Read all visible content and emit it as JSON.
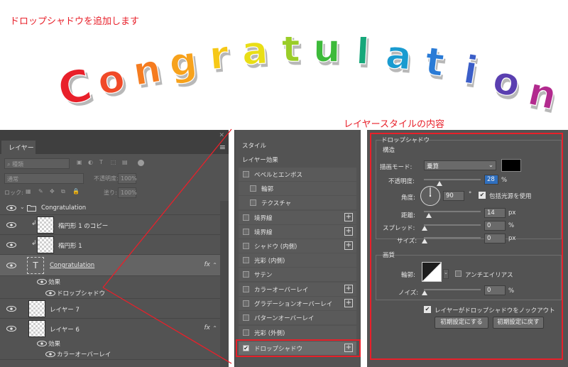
{
  "annotations": {
    "top": "ドロップシャドウを追加します",
    "layer_style": "レイヤースタイルの内容"
  },
  "hero": {
    "letters": [
      {
        "ch": "C",
        "color": "#e8202a"
      },
      {
        "ch": "o",
        "color": "#f04a28"
      },
      {
        "ch": "n",
        "color": "#f57c20"
      },
      {
        "ch": "g",
        "color": "#f7a21c"
      },
      {
        "ch": "r",
        "color": "#f6c817"
      },
      {
        "ch": "a",
        "color": "#e9de16"
      },
      {
        "ch": "t",
        "color": "#9acd28"
      },
      {
        "ch": "u",
        "color": "#3dba3a"
      },
      {
        "ch": "l",
        "color": "#16a77a"
      },
      {
        "ch": "a",
        "color": "#1a9bd0"
      },
      {
        "ch": "t",
        "color": "#2a7bd6"
      },
      {
        "ch": "i",
        "color": "#3b5ec8"
      },
      {
        "ch": "o",
        "color": "#5a3fb0"
      },
      {
        "ch": "n",
        "color": "#b22a8e"
      }
    ]
  },
  "layers_panel": {
    "tab": "レイヤー",
    "close": "✕",
    "search_placeholder": "種類",
    "blend_mode": "通常",
    "opacity_label": "不透明度:",
    "opacity_value": "100%",
    "lock_label": "ロック:",
    "fill_label": "塗り:",
    "fill_value": "100%",
    "layers": [
      {
        "name": "Congratulation",
        "type": "group"
      },
      {
        "name": "楕円形 1 のコピー",
        "type": "clipped"
      },
      {
        "name": "楕円形 1",
        "type": "clipped"
      },
      {
        "name": "Congratulation",
        "type": "text",
        "fx": "fx"
      },
      {
        "name": "効果",
        "type": "effect-header"
      },
      {
        "name": "ドロップシャドウ",
        "type": "effect"
      },
      {
        "name": "レイヤー 7",
        "type": "layer"
      },
      {
        "name": "レイヤー 6",
        "type": "layer",
        "fx": "fx"
      },
      {
        "name": "効果",
        "type": "effect-header"
      },
      {
        "name": "カラーオーバーレイ",
        "type": "effect"
      }
    ]
  },
  "style_list": {
    "items": [
      {
        "label": "スタイル"
      },
      {
        "label": "レイヤー効果"
      },
      {
        "label": "ベベルとエンボス",
        "checked": false
      },
      {
        "label": "輪郭",
        "checked": false
      },
      {
        "label": "テクスチャ",
        "checked": false
      },
      {
        "label": "境界線",
        "checked": false
      },
      {
        "label": "境界線",
        "checked": false
      },
      {
        "label": "シャドウ (内側)",
        "checked": false
      },
      {
        "label": "光彩 (内側)",
        "checked": false
      },
      {
        "label": "サテン",
        "checked": false
      },
      {
        "label": "カラーオーバーレイ",
        "checked": false
      },
      {
        "label": "グラデーションオーバーレイ",
        "checked": false
      },
      {
        "label": "パターンオーバーレイ",
        "checked": false
      },
      {
        "label": "光彩 (外側)",
        "checked": false
      },
      {
        "label": "ドロップシャドウ",
        "checked": true
      }
    ],
    "plus": "+"
  },
  "drop_shadow": {
    "title": "ドロップシャドウ",
    "structure": "構造",
    "blend_mode_label": "描画モード:",
    "blend_mode_value": "乗算",
    "shadow_color": "#000000",
    "opacity_label": "不透明度:",
    "opacity_value": "28",
    "opacity_fraction": 0.28,
    "percent": "%",
    "angle_label": "角度:",
    "angle_value": "90",
    "degree": "°",
    "global_light_label": "包括光源を使用",
    "distance_label": "距離:",
    "distance_value": "14",
    "px": "px",
    "spread_label": "スプレッド:",
    "spread_value": "0",
    "size_label": "サイズ:",
    "size_value": "0",
    "quality": "画質",
    "contour_label": "輪郭:",
    "antialias_label": "アンチエイリアス",
    "noise_label": "ノイズ:",
    "noise_value": "0",
    "knockout_label": "レイヤーがドロップシャドウをノックアウト",
    "default_button": "初期設定にする",
    "reset_button": "初期設定に戻す"
  }
}
